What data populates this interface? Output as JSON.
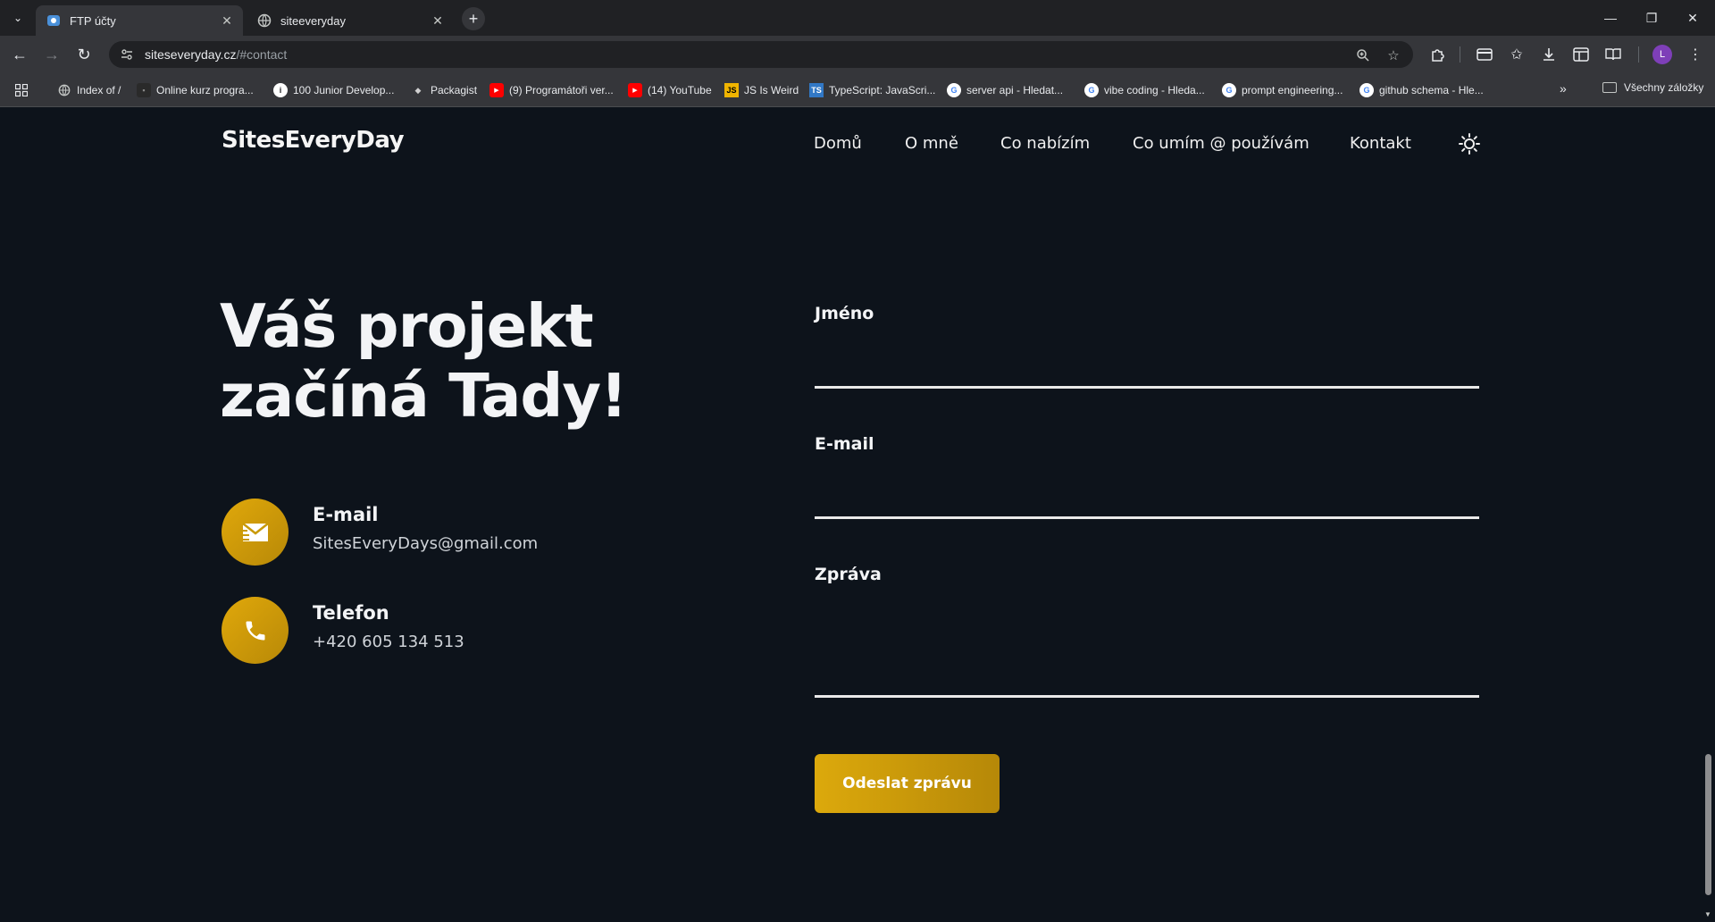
{
  "browser": {
    "tabs": [
      {
        "title": "FTP účty",
        "active": true
      },
      {
        "title": "siteeveryday",
        "active": false
      }
    ],
    "url_host": "siteseveryday.cz",
    "url_path": "/#contact",
    "profile_initial": "L",
    "bookmarks": [
      {
        "label": "Index of /",
        "icon": "globe-icon"
      },
      {
        "label": "Online kurz progra...",
        "icon": "site-icon"
      },
      {
        "label": "100 Junior Develop...",
        "icon": "info-icon"
      },
      {
        "label": "Packagist",
        "icon": "packagist-icon"
      },
      {
        "label": "(9) Programátoři ver...",
        "icon": "youtube-icon"
      },
      {
        "label": "(14) YouTube",
        "icon": "youtube-icon"
      },
      {
        "label": "JS Is Weird",
        "icon": "js-icon"
      },
      {
        "label": "TypeScript: JavaScri...",
        "icon": "ts-icon"
      },
      {
        "label": "server api - Hledat...",
        "icon": "google-icon"
      },
      {
        "label": "vibe coding - Hleda...",
        "icon": "google-icon"
      },
      {
        "label": "prompt engineering...",
        "icon": "google-icon"
      },
      {
        "label": "github schema - Hle...",
        "icon": "google-icon"
      }
    ],
    "all_bookmarks_label": "Všechny záložky",
    "bookmarks_more": "»"
  },
  "site": {
    "logo": "SitesEveryDay",
    "nav": [
      "Domů",
      "O mně",
      "Co nabízím",
      "Co umím @ používám",
      "Kontakt"
    ],
    "hero_line1": "Váš projekt",
    "hero_line2": "začíná Tady!",
    "contacts": [
      {
        "label": "E-mail",
        "value": "SitesEveryDays@gmail.com",
        "icon": "mail-icon"
      },
      {
        "label": "Telefon",
        "value": "+420 605 134 513",
        "icon": "phone-icon"
      }
    ],
    "form": {
      "name_label": "Jméno",
      "email_label": "E-mail",
      "message_label": "Zpráva",
      "submit_label": "Odeslat zprávu"
    },
    "accent_color": "#d8a40a",
    "background_color": "#0d131b"
  }
}
